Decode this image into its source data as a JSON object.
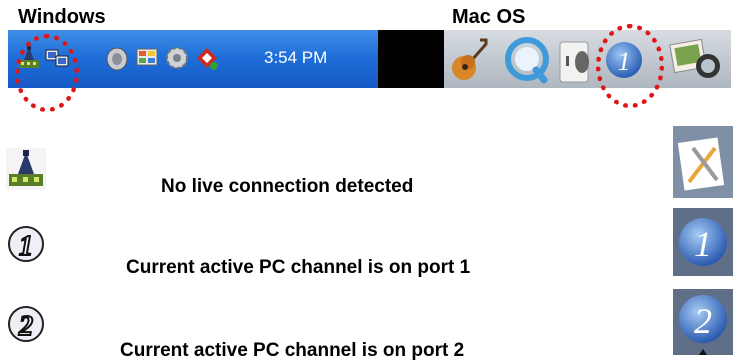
{
  "headings": {
    "windows": "Windows",
    "mac": "Mac OS"
  },
  "windows_taskbar": {
    "clock": "3:54 PM",
    "icons": [
      "network-switch-icon",
      "network-computers-icon",
      "speaker-icon",
      "network-tray-icon",
      "settings-tray-icon",
      "program-tray-icon"
    ]
  },
  "mac_dock": {
    "icons": [
      "guitar-app-icon",
      "quicktime-icon",
      "switch-icon",
      "channel-1-icon",
      "preview-icon"
    ]
  },
  "legend": [
    {
      "windows_icon": "switch-icon",
      "mac_icon": "app-placeholder-icon",
      "text": "No live connection detected"
    },
    {
      "windows_icon": "port-1-icon",
      "mac_icon": "channel-1-icon",
      "number": "1",
      "text": "Current active PC channel is on port 1"
    },
    {
      "windows_icon": "port-2-icon",
      "mac_icon": "channel-2-icon",
      "number": "2",
      "text": "Current active PC channel is on port 2"
    }
  ],
  "colors": {
    "taskbar_blue": "#1f6fd9",
    "highlight_red": "#e01616",
    "dock_gray": "#c2c9d0"
  }
}
